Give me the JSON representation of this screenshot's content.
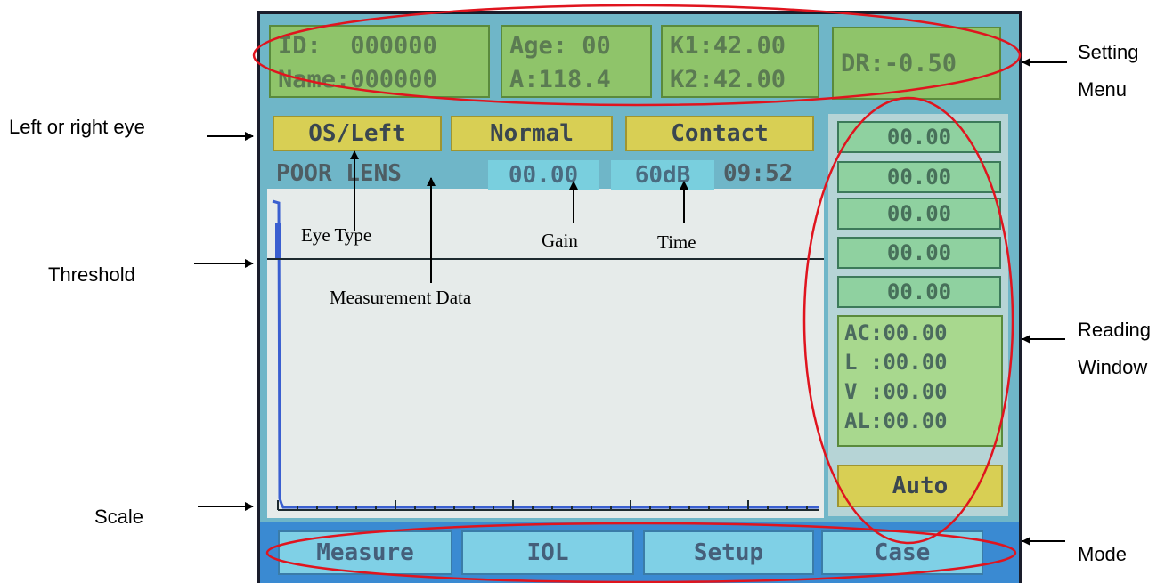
{
  "header": {
    "id": "ID:  000000",
    "name": "Name:000000",
    "age": "Age: 00",
    "a_const": "A:118.4",
    "k1": "K1:42.00",
    "k2": "K2:42.00",
    "dr": "DR:-0.50"
  },
  "eye_buttons": {
    "eye": "OS/Left",
    "normal": "Normal",
    "contact": "Contact"
  },
  "status": {
    "lens": "POOR LENS",
    "gain": "00.00",
    "db": "60dB",
    "time": "09:52"
  },
  "reading_boxes": [
    "00.00",
    "00.00",
    "00.00",
    "00.00",
    "00.00"
  ],
  "readings": [
    "AC:00.00",
    "L :00.00",
    "V :00.00",
    "AL:00.00"
  ],
  "auto_label": "Auto",
  "modes": [
    "Measure",
    "IOL",
    "Setup",
    "Case"
  ],
  "annotations": {
    "setting_menu_1": "Setting",
    "setting_menu_2": "Menu",
    "left_right_eye": "Left or right eye",
    "eye_type": "Eye Type",
    "gain": "Gain",
    "time": "Time",
    "threshold": "Threshold",
    "measurement_data": "Measurement Data",
    "reading_window_1": "Reading",
    "reading_window_2": "Window",
    "scale": "Scale",
    "mode": "Mode"
  },
  "colors": {
    "lcd_background": "#6fb6c8",
    "field_green": "#8fc46a",
    "button_yellow": "#d8cf54",
    "mode_bar": "#3a8ad2",
    "highlight_ellipse": "#e0141e",
    "waveform": "#3a5fd0"
  }
}
